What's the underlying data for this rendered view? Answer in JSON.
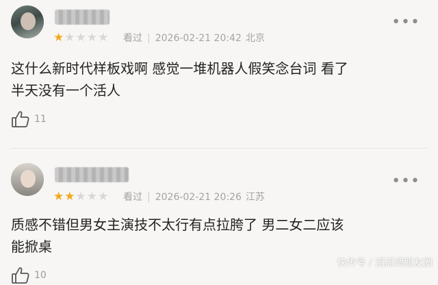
{
  "reviews": [
    {
      "rating": 1,
      "max_rating": 5,
      "watched_label": "看过",
      "datetime": "2026-02-21 20:42",
      "location": "北京",
      "text": "这什么新时代样板戏啊 感觉一堆机器人假笑念台词 看了\n半天没有一个活人",
      "like_count": "11",
      "more_icon": "more-dots-icon"
    },
    {
      "rating": 2,
      "max_rating": 5,
      "watched_label": "看过",
      "datetime": "2026-02-21 20:26",
      "location": "江苏",
      "text": "质感不错但男女主演技不太行有点拉胯了 男二女二应该\n能掀桌",
      "like_count": "10",
      "more_icon": "more-dots-icon"
    }
  ],
  "watermark": "快传号 / 滔滔调朋友圈"
}
